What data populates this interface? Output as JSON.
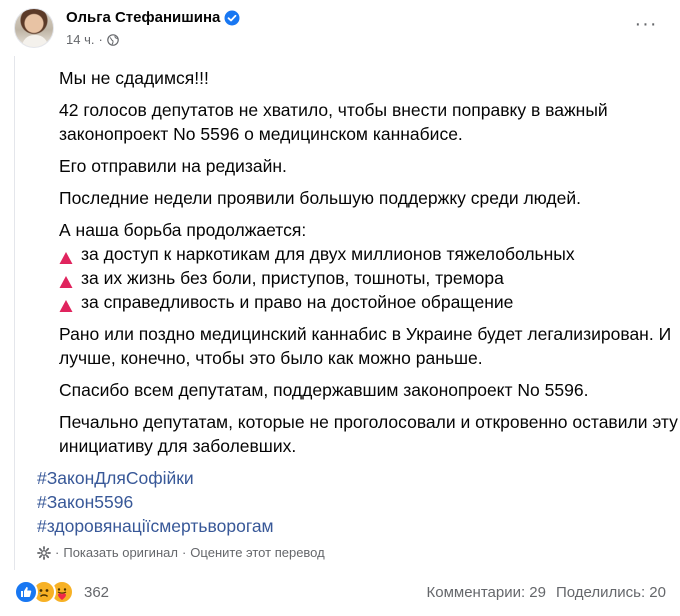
{
  "post": {
    "author": "Ольга Стефанишина",
    "time": "14 ч.",
    "dot": "·",
    "more": "···"
  },
  "body": {
    "p1": "Мы не сдадимся!!!",
    "p2": "42 голосов депутатов не хватило, чтобы внести поправку в важный законопроект No 5596 о медицинском каннабисе.",
    "p3": "Его отправили на редизайн.",
    "p4": "Последние недели проявили большую поддержку среди людей.",
    "p5": "А наша борьба продолжается:",
    "bullets": [
      "за доступ к наркотикам для двух миллионов тяжелобольных",
      "за их жизнь без боли, приступов, тошноты, тремора",
      "за справедливость и право на достойное обращение"
    ],
    "p6": "Рано или поздно медицинский каннабис в Украине будет легализирован. И лучше, конечно, чтобы это было как можно раньше.",
    "p7": "Спасибо всем депутатам, поддержавшим законопроект No 5596.",
    "p8": "Печально депутатам, которые не проголосовали и откровенно оставили эту инициативу для заболевших.",
    "hashtags": [
      "#ЗаконДляСофійки",
      "#Закон5596",
      "#здоровянаціїсмертьворогам"
    ]
  },
  "translate": {
    "show_original": "Показать оригинал",
    "rate": "Оцените этот перевод",
    "dot": "·"
  },
  "footer": {
    "reaction_count": "362",
    "comments": "Комментарии: 29",
    "shares": "Поделились: 20"
  },
  "icons": {
    "verified": "verified-badge-icon",
    "globe": "globe-icon",
    "gear": "gear-icon",
    "bullet": "red-triangle-icon",
    "reactions": [
      "like-icon",
      "sad-icon",
      "care-icon"
    ]
  },
  "colors": {
    "accent": "#1877f2",
    "link": "#385898",
    "secondary_text": "#65676b",
    "bullet_red": "#e0245e"
  }
}
